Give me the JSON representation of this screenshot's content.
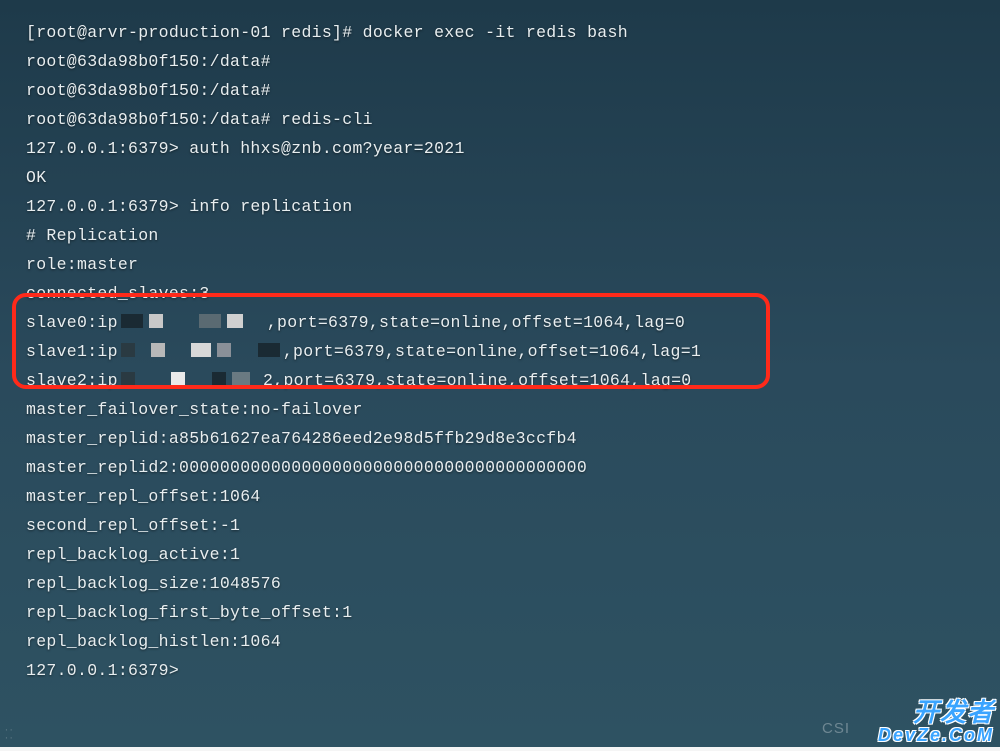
{
  "terminal": {
    "lines": {
      "l0": "[root@arvr-production-01 redis]# docker exec -it redis bash",
      "l1": "root@63da98b0f150:/data#",
      "l2": "root@63da98b0f150:/data#",
      "l3": "root@63da98b0f150:/data# redis-cli",
      "l4": "127.0.0.1:6379> auth hhxs@znb.com?year=2021",
      "l5": "OK",
      "l6": "127.0.0.1:6379> info replication",
      "l7": "# Replication",
      "l8": "role:master",
      "l9": "connected_slaves:3",
      "s0a": "slave0:ip",
      "s0b": ",port=6379,state=online,offset=1064,lag=0",
      "s1a": "slave1:ip",
      "s1b": ",port=6379,state=online,offset=1064,lag=1",
      "s2a": "slave2:ip",
      "s2b": "2,port=6379,state=online,offset=1064,lag=0",
      "l13": "master_failover_state:no-failover",
      "l14": "master_replid:a85b61627ea764286eed2e98d5ffb29d8e3ccfb4",
      "l15": "master_replid2:0000000000000000000000000000000000000000",
      "l16": "master_repl_offset:1064",
      "l17": "second_repl_offset:-1",
      "l18": "repl_backlog_active:1",
      "l19": "repl_backlog_size:1048576",
      "l20": "repl_backlog_first_byte_offset:1",
      "l21": "repl_backlog_histlen:1064",
      "l22": "127.0.0.1:6379>"
    }
  },
  "watermark": {
    "csdn": "CSI",
    "brand_cn": "开发者",
    "brand_en": "DevZe.CoM"
  }
}
